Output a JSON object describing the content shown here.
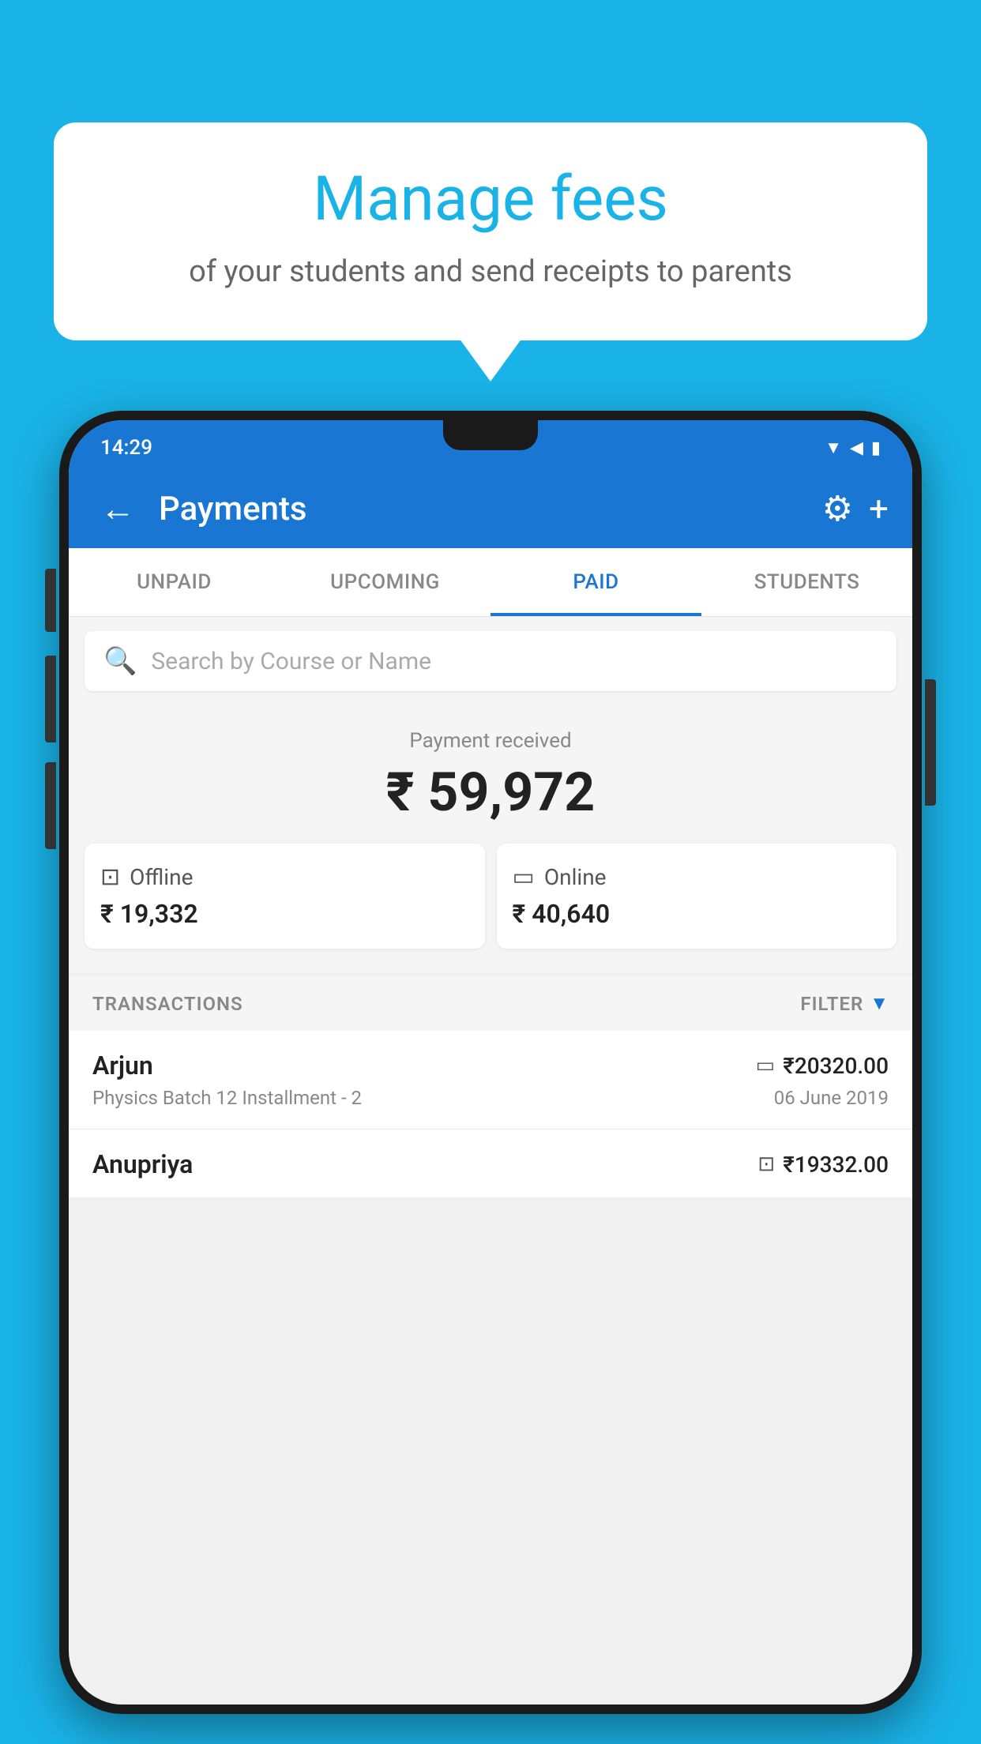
{
  "background_color": "#1ab3e8",
  "speech_bubble": {
    "title": "Manage fees",
    "subtitle": "of your students and send receipts to parents"
  },
  "status_bar": {
    "time": "14:29",
    "icons": [
      "wifi",
      "signal",
      "battery"
    ]
  },
  "app_bar": {
    "title": "Payments",
    "back_label": "←",
    "gear_label": "⚙",
    "plus_label": "+"
  },
  "tabs": [
    {
      "label": "UNPAID",
      "active": false
    },
    {
      "label": "UPCOMING",
      "active": false
    },
    {
      "label": "PAID",
      "active": true
    },
    {
      "label": "STUDENTS",
      "active": false
    }
  ],
  "search": {
    "placeholder": "Search by Course or Name"
  },
  "payment_summary": {
    "received_label": "Payment received",
    "total_amount": "₹ 59,972",
    "offline": {
      "type": "Offline",
      "amount": "₹ 19,332"
    },
    "online": {
      "type": "Online",
      "amount": "₹ 40,640"
    }
  },
  "transactions": {
    "header_label": "TRANSACTIONS",
    "filter_label": "FILTER",
    "rows": [
      {
        "name": "Arjun",
        "detail": "Physics Batch 12 Installment - 2",
        "amount": "₹20320.00",
        "date": "06 June 2019",
        "icon_type": "online"
      },
      {
        "name": "Anupriya",
        "detail": "",
        "amount": "₹19332.00",
        "date": "",
        "icon_type": "offline"
      }
    ]
  }
}
